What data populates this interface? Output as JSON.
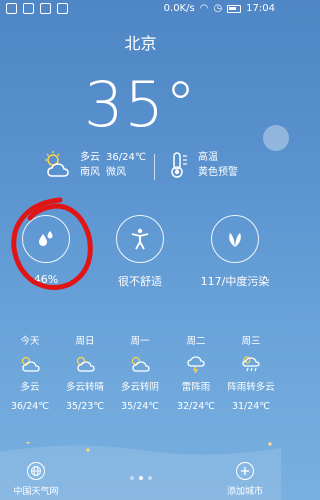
{
  "status_bar": {
    "speed": "0.0K/s",
    "time": "17:04"
  },
  "weather": {
    "city": "北京",
    "temperature": "35°",
    "condition": "多云",
    "temp_range": "36/24℃",
    "wind_dir": "南风",
    "wind_level": "微风",
    "alert_top": "高温",
    "alert_bottom": "黄色预警"
  },
  "indices": [
    {
      "label": "46%",
      "icon": "humidity-drops-icon"
    },
    {
      "label": "很不舒适",
      "icon": "body-comfort-icon"
    },
    {
      "label": "117/中度污染",
      "icon": "air-quality-leaf-icon"
    }
  ],
  "forecast": [
    {
      "day": "今天",
      "condition": "多云",
      "temps": "36/24℃",
      "icon": "partly-cloudy-icon"
    },
    {
      "day": "周日",
      "condition": "多云转晴",
      "temps": "35/23℃",
      "icon": "partly-cloudy-icon"
    },
    {
      "day": "周一",
      "condition": "多云转阴",
      "temps": "35/24℃",
      "icon": "partly-cloudy-icon"
    },
    {
      "day": "周二",
      "condition": "雷阵雨",
      "temps": "32/24℃",
      "icon": "thunderstorm-icon"
    },
    {
      "day": "周三",
      "condition": "阵雨转多云",
      "temps": "31/24℃",
      "icon": "shower-icon"
    }
  ],
  "bottom": {
    "left_label": "中国天气网",
    "right_label": "添加城市"
  },
  "colors": {
    "bg_top": "#4f86c5",
    "bg_bottom": "#79b0e0",
    "annotation": "#e01616"
  }
}
